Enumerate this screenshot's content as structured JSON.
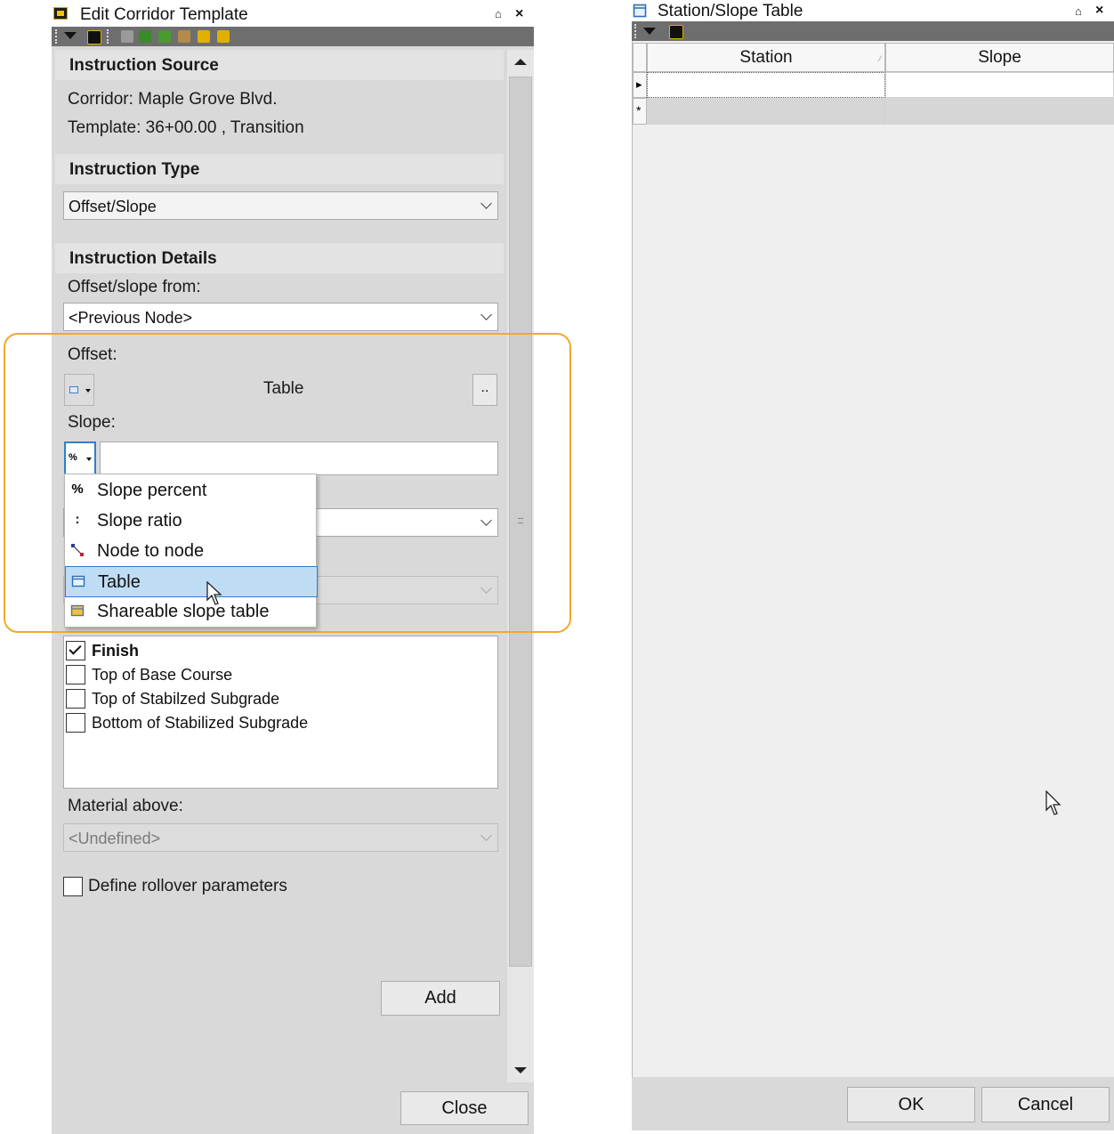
{
  "left_window": {
    "title": "Edit Corridor Template",
    "pin_glyph": "⌂",
    "close_glyph": "×",
    "toolbar_icons": [
      "dropdown-icon",
      "camera-icon",
      "grid-icon",
      "layers-icon",
      "map-icon",
      "surface-icon",
      "warning-icon",
      "text-icon"
    ],
    "instruction_source": {
      "heading": "Instruction Source",
      "corridor": "Corridor: Maple Grove Blvd.",
      "template": "Template: 36+00.00 , Transition"
    },
    "instruction_type": {
      "heading": "Instruction Type",
      "selected": "Offset/Slope"
    },
    "instruction_details": {
      "heading": "Instruction Details",
      "offset_from_label": "Offset/slope from:",
      "offset_from_value": "<Previous Node>",
      "offset_label": "Offset:",
      "offset_value": "Table",
      "offset_button": "..",
      "slope_label": "Slope:",
      "slope_type_glyph": "%",
      "slope_value": ""
    },
    "slope_menu": {
      "items": [
        {
          "label": "Slope percent",
          "icon": "percent-icon",
          "glyph": "%"
        },
        {
          "label": "Slope ratio",
          "icon": "ratio-icon",
          "glyph": ":"
        },
        {
          "label": "Node to node",
          "icon": "node-to-node-icon",
          "glyph": ""
        },
        {
          "label": "Table",
          "icon": "table-icon",
          "glyph": ""
        },
        {
          "label": "Shareable slope table",
          "icon": "shareable-table-icon",
          "glyph": ""
        }
      ],
      "selected_index": 3
    },
    "layers": [
      {
        "label": "Finish",
        "checked": true,
        "bold": true
      },
      {
        "label": "Top of Base Course",
        "checked": false
      },
      {
        "label": "Top of Stabilzed Subgrade",
        "checked": false
      },
      {
        "label": "Bottom of Stabilized Subgrade",
        "checked": false
      }
    ],
    "material_above_label": "Material above:",
    "material_above_value": "<Undefined>",
    "rollover_label": "Define rollover parameters",
    "add_button": "Add",
    "close_button": "Close",
    "highlight_color": "#f0a92e"
  },
  "right_window": {
    "title": "Station/Slope Table",
    "pin_glyph": "⌂",
    "close_glyph": "×",
    "columns": [
      "Station",
      "Slope"
    ],
    "rows": [
      {
        "marker": "▸",
        "station": "",
        "slope": ""
      },
      {
        "marker": "*",
        "station": "",
        "slope": ""
      }
    ],
    "ok_button": "OK",
    "cancel_button": "Cancel"
  }
}
